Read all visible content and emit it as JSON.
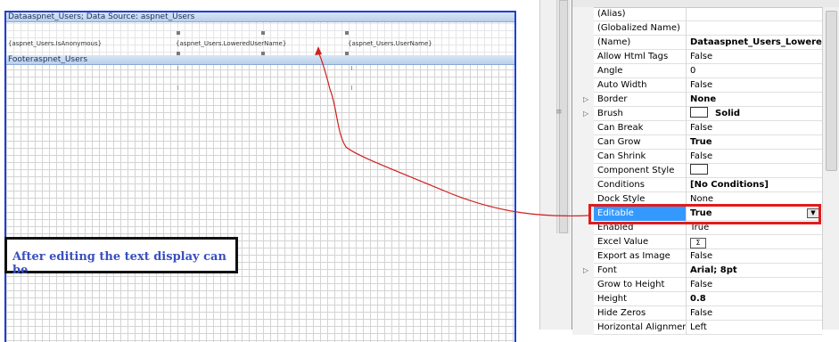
{
  "designer": {
    "data_band_title": "Dataaspnet_Users; Data Source: aspnet_Users",
    "footer_band_title": "Footeraspnet_Users",
    "cells": [
      "{aspnet_Users.IsAnonymous}",
      "{aspnet_Users.LoweredUserName}",
      "{aspnet_Users.UserName}"
    ],
    "annotation": "After editing the text display can be"
  },
  "properties": [
    {
      "name": "(Alias)",
      "value": "",
      "expander": false
    },
    {
      "name": "(Globalized Name)",
      "value": "",
      "expander": false
    },
    {
      "name": "(Name)",
      "value": "Dataaspnet_Users_LoweredUserName",
      "bold": true,
      "expander": false
    },
    {
      "name": "Allow Html Tags",
      "value": "False",
      "expander": false
    },
    {
      "name": "Angle",
      "value": "0",
      "expander": false
    },
    {
      "name": "Auto Width",
      "value": "False",
      "expander": false
    },
    {
      "name": "Border",
      "value": "None",
      "bold": true,
      "expander": true
    },
    {
      "name": "Brush",
      "value": "Solid",
      "bold": true,
      "expander": true,
      "swatch": true
    },
    {
      "name": "Can Break",
      "value": "False",
      "expander": false
    },
    {
      "name": "Can Grow",
      "value": "True",
      "bold": true,
      "expander": false
    },
    {
      "name": "Can Shrink",
      "value": "False",
      "expander": false
    },
    {
      "name": "Component Style",
      "value": "",
      "expander": false,
      "swatch": true
    },
    {
      "name": "Conditions",
      "value": "[No Conditions]",
      "bold": true,
      "expander": false
    },
    {
      "name": "Dock Style",
      "value": "None",
      "expander": false
    },
    {
      "name": "Editable",
      "value": "True",
      "bold": true,
      "expander": false,
      "selected": true
    },
    {
      "name": "Enabled",
      "value": "True",
      "expander": false
    },
    {
      "name": "Excel Value",
      "value": "",
      "expander": false,
      "sigma": "Σ"
    },
    {
      "name": "Export as Image",
      "value": "False",
      "expander": false
    },
    {
      "name": "Font",
      "value": "Arial; 8pt",
      "bold": true,
      "expander": true
    },
    {
      "name": "Grow to Height",
      "value": "False",
      "expander": false
    },
    {
      "name": "Height",
      "value": "0.8",
      "bold": true,
      "expander": false
    },
    {
      "name": "Hide Zeros",
      "value": "False",
      "expander": false
    },
    {
      "name": "Horizontal Alignment",
      "value": "Left",
      "expander": false
    }
  ],
  "colors": {
    "highlight": "#e01c1c",
    "selection": "#3399ff",
    "page_border": "#1f3fd6",
    "annotation_text": "#3a4fbf"
  }
}
